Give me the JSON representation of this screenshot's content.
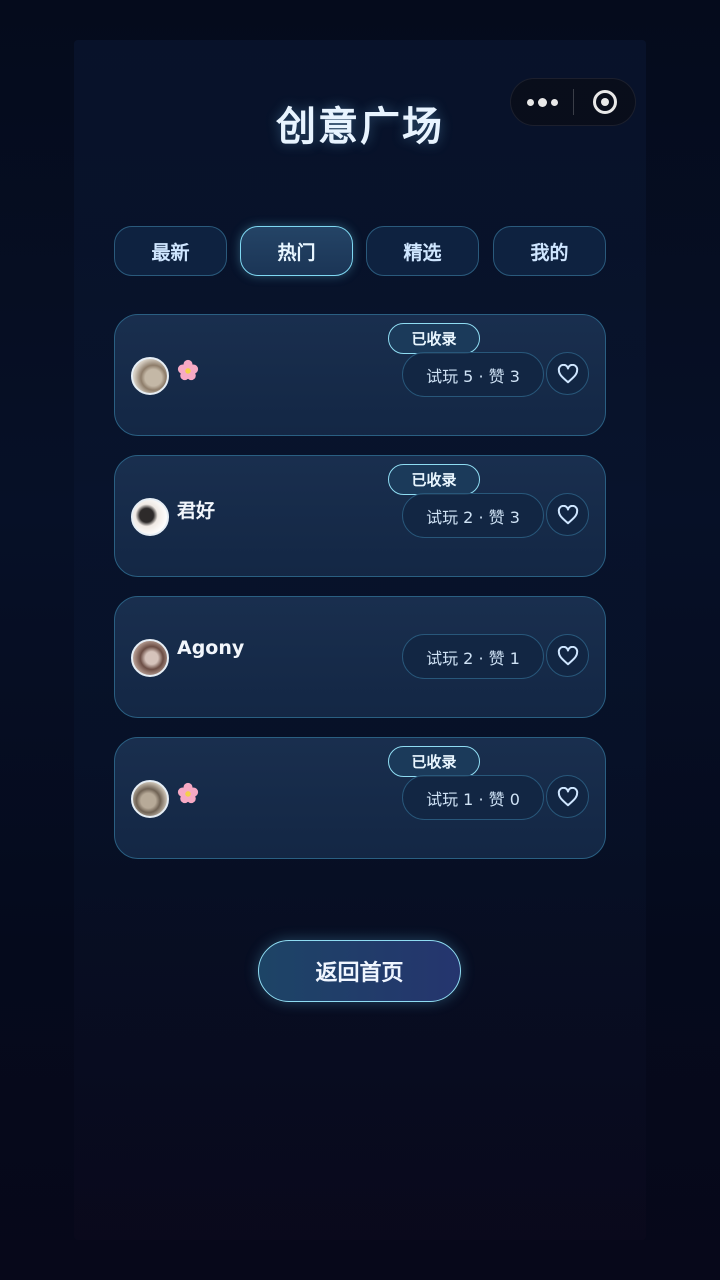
{
  "header": {
    "title": "创意广场"
  },
  "tabs": [
    {
      "label": "最新",
      "active": false
    },
    {
      "label": "热门",
      "active": true
    },
    {
      "label": "精选",
      "active": false
    },
    {
      "label": "我的",
      "active": false
    }
  ],
  "cards": [
    {
      "name": "",
      "emoji": "flower-icon",
      "badge": "已收录",
      "stats": "试玩 5 · 赞 3"
    },
    {
      "name": "君好",
      "badge": "已收录",
      "stats": "试玩 2 · 赞 3"
    },
    {
      "name": "Agony",
      "badge": "",
      "stats": "试玩 2 · 赞 1"
    },
    {
      "name": "",
      "emoji": "flower-icon",
      "badge": "已收录",
      "stats": "试玩 1 · 赞 0"
    }
  ],
  "footer": {
    "back_label": "返回首页"
  },
  "colors": {
    "accent": "#8fdcf2",
    "card_border": "#2a5f82",
    "background": "#050b1c"
  }
}
